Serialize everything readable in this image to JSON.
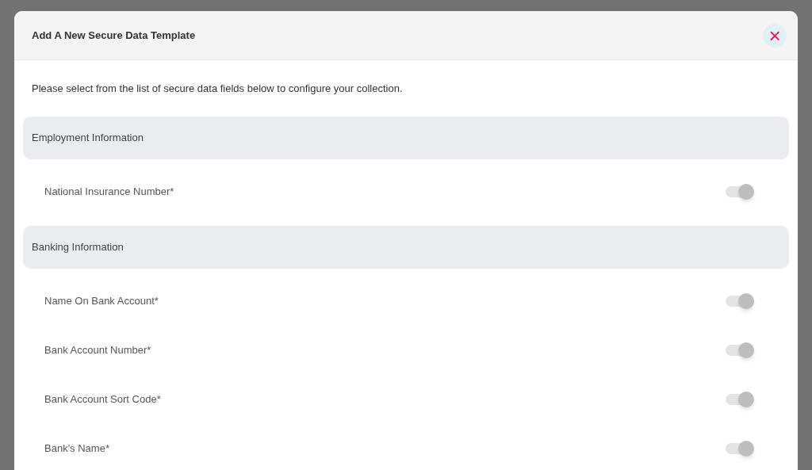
{
  "dialog": {
    "title": "Add A New Secure Data Template",
    "close_icon": "×",
    "description": "Please select from the list of secure data fields below to configure your collection.",
    "sections": [
      {
        "title": "Employment Information",
        "fields": [
          {
            "label": "National Insurance Number*",
            "on": true
          }
        ]
      },
      {
        "title": "Banking Information",
        "fields": [
          {
            "label": "Name On Bank Account*",
            "on": true
          },
          {
            "label": "Bank Account Number*",
            "on": true
          },
          {
            "label": "Bank Account Sort Code*",
            "on": true
          },
          {
            "label": "Bank's Name*",
            "on": true
          }
        ]
      }
    ]
  }
}
